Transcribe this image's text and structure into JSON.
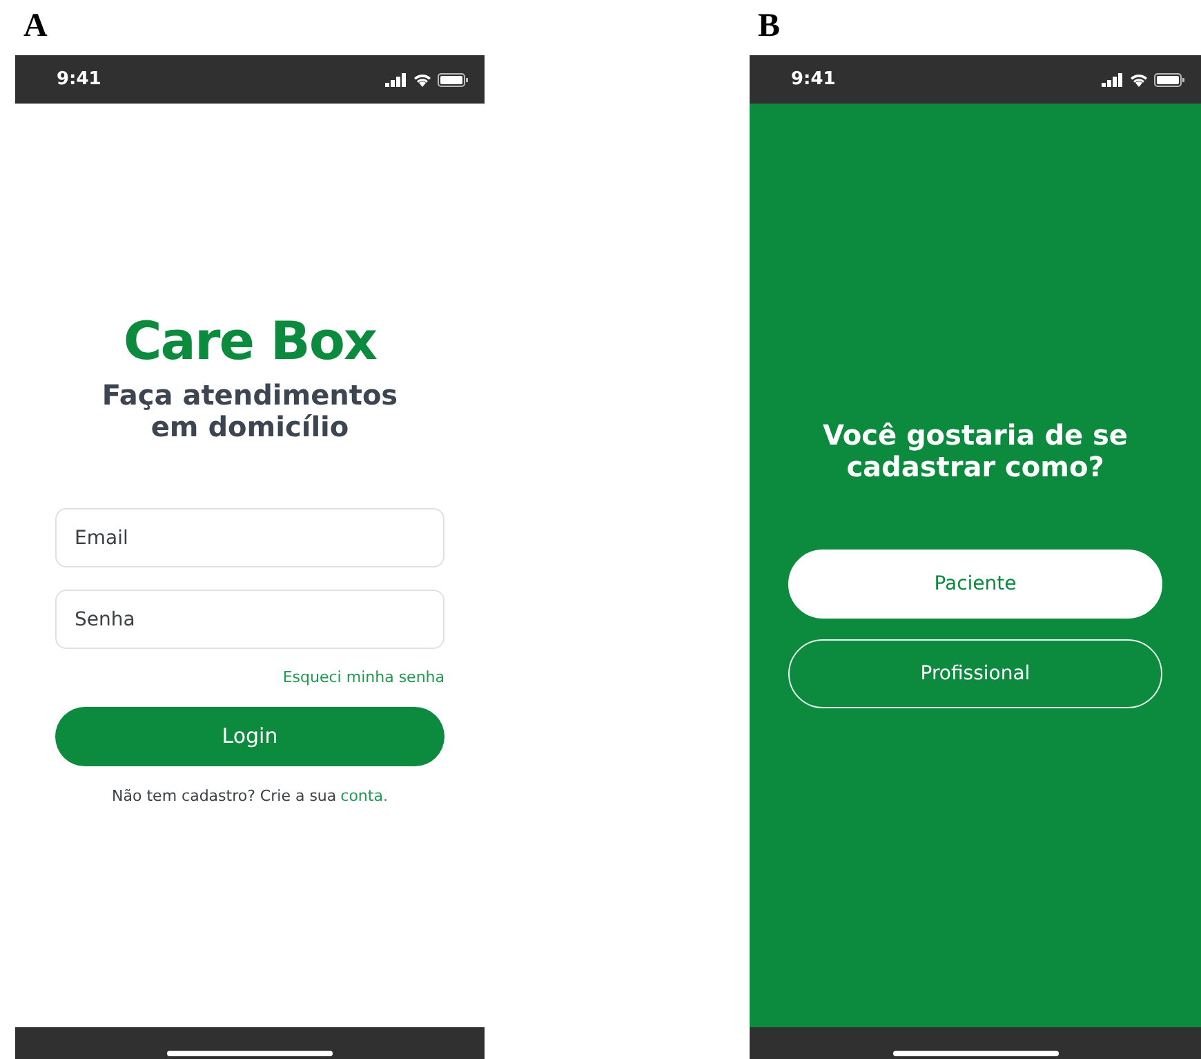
{
  "panels": [
    {
      "label": "A",
      "kind": "login",
      "status_bar": {
        "time": "9:41"
      },
      "logo": "Care Box",
      "subtitle": "Faça atendimentos em domicílio",
      "fields": [
        {
          "placeholder": "Email"
        },
        {
          "placeholder": "Senha"
        }
      ],
      "forgot_link": "Esqueci minha senha",
      "login_button": "Login",
      "signup_text": "Não tem cadastro? Crie a sua",
      "signup_link": "conta."
    },
    {
      "label": "B",
      "kind": "choice",
      "status_bar": {
        "time": "9:41"
      },
      "question": "Você gostaria de se cadastrar como?",
      "options": [
        {
          "label": "Paciente",
          "selected": true
        },
        {
          "label": "Profissional",
          "selected": false
        }
      ]
    }
  ]
}
